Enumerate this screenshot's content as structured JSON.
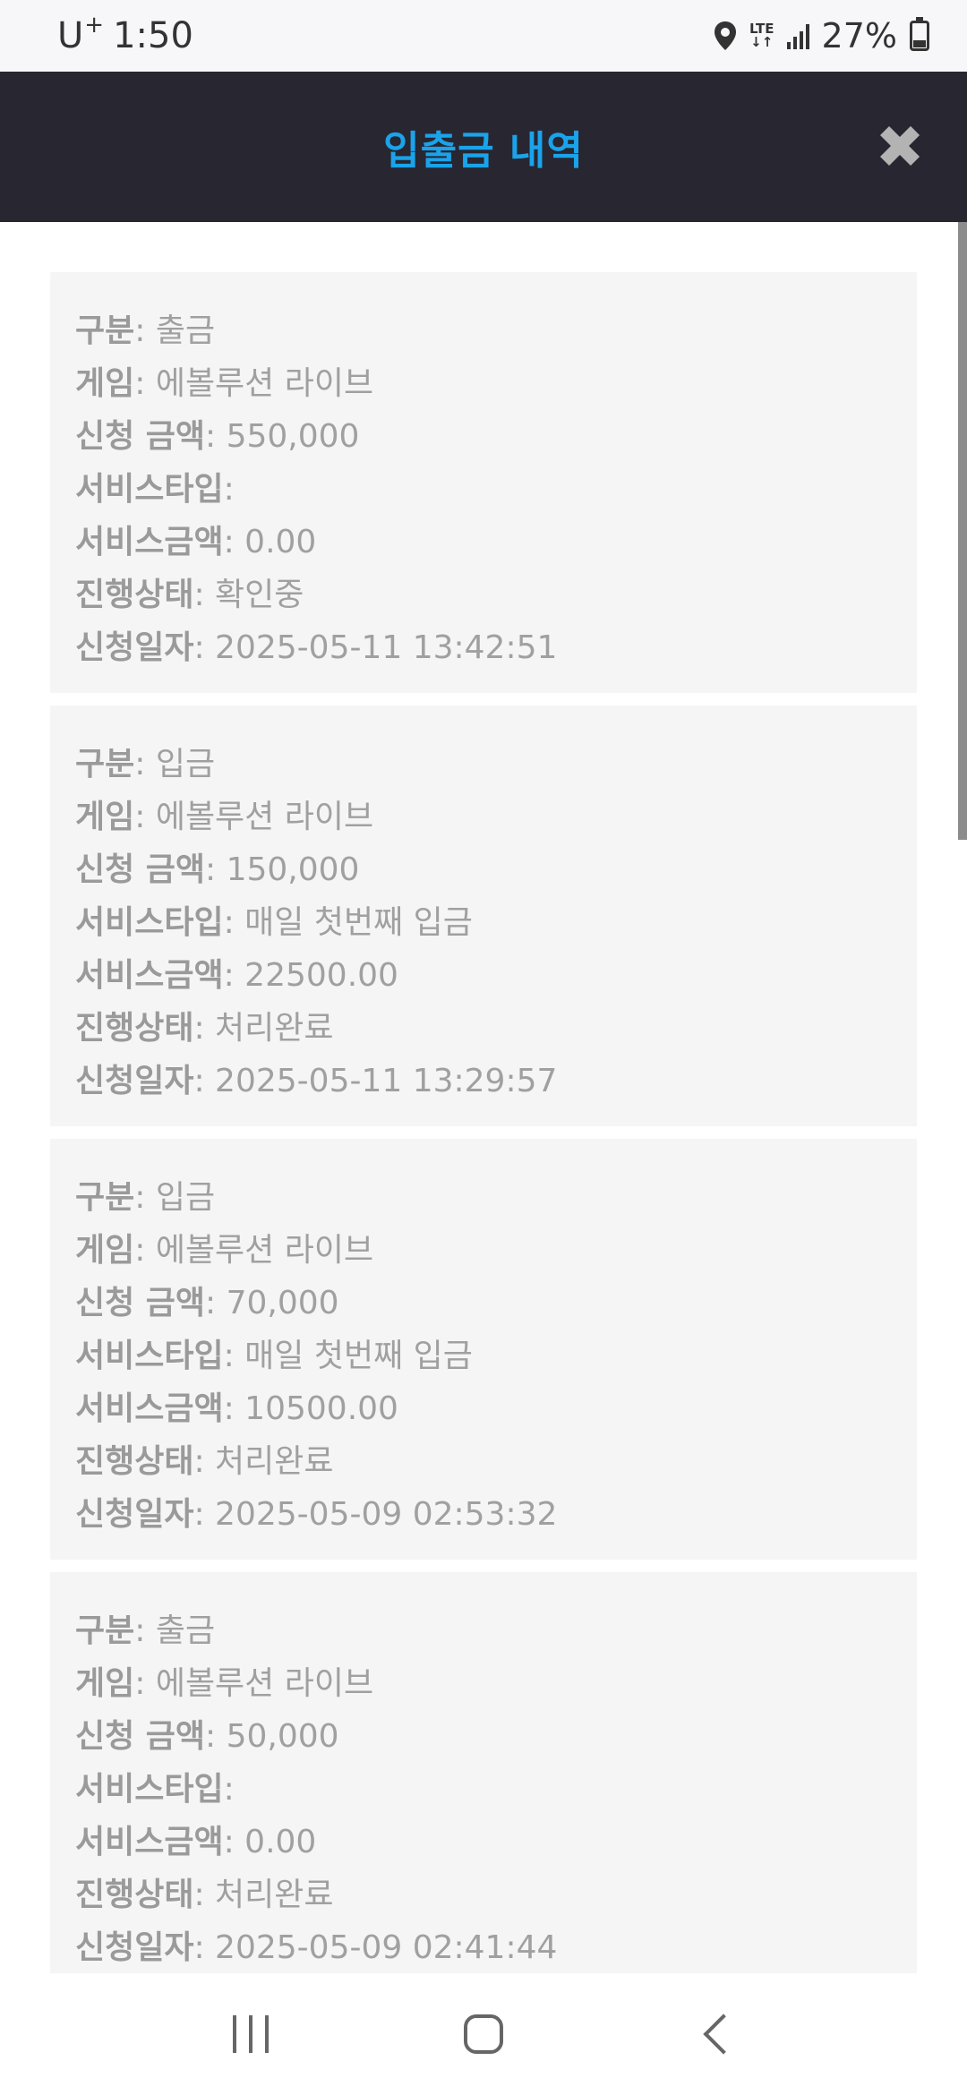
{
  "status_bar": {
    "carrier": "U",
    "carrier_plus": "+",
    "time": "1:50",
    "network": "LTE",
    "battery": "27%"
  },
  "header": {
    "title": "입출금 내역",
    "close_symbol": "✖"
  },
  "labels": {
    "type": "구분",
    "game": "게임",
    "amount": "신청 금액",
    "service_type": "서비스타입",
    "service_amount": "서비스금액",
    "status": "진행상태",
    "date": "신청일자"
  },
  "transactions": [
    {
      "type": ": 출금",
      "game": ": 에볼루션 라이브",
      "amount": ": 550,000",
      "service_type": ":",
      "service_amount": ": 0.00",
      "status": ": 확인중",
      "date": ": 2025-05-11 13:42:51"
    },
    {
      "type": ": 입금",
      "game": ": 에볼루션 라이브",
      "amount": ": 150,000",
      "service_type": ": 매일 첫번째 입금",
      "service_amount": ": 22500.00",
      "status": ": 처리완료",
      "date": ": 2025-05-11 13:29:57"
    },
    {
      "type": ": 입금",
      "game": ": 에볼루션 라이브",
      "amount": ": 70,000",
      "service_type": ": 매일 첫번째 입금",
      "service_amount": ": 10500.00",
      "status": ": 처리완료",
      "date": ": 2025-05-09 02:53:32"
    },
    {
      "type": ": 출금",
      "game": ": 에볼루션 라이브",
      "amount": ": 50,000",
      "service_type": ":",
      "service_amount": ": 0.00",
      "status": ": 처리완료",
      "date": ": 2025-05-09 02:41:44"
    }
  ],
  "colors": {
    "header_bg": "#272631",
    "title": "#1aa3ea",
    "card_bg": "#f5f5f5",
    "text": "#a0a0a0"
  },
  "icons": {
    "close": "close-icon",
    "location": "location-icon",
    "signal": "signal-icon",
    "battery": "battery-icon",
    "recents": "recents-icon",
    "home": "home-icon",
    "back": "back-icon"
  }
}
